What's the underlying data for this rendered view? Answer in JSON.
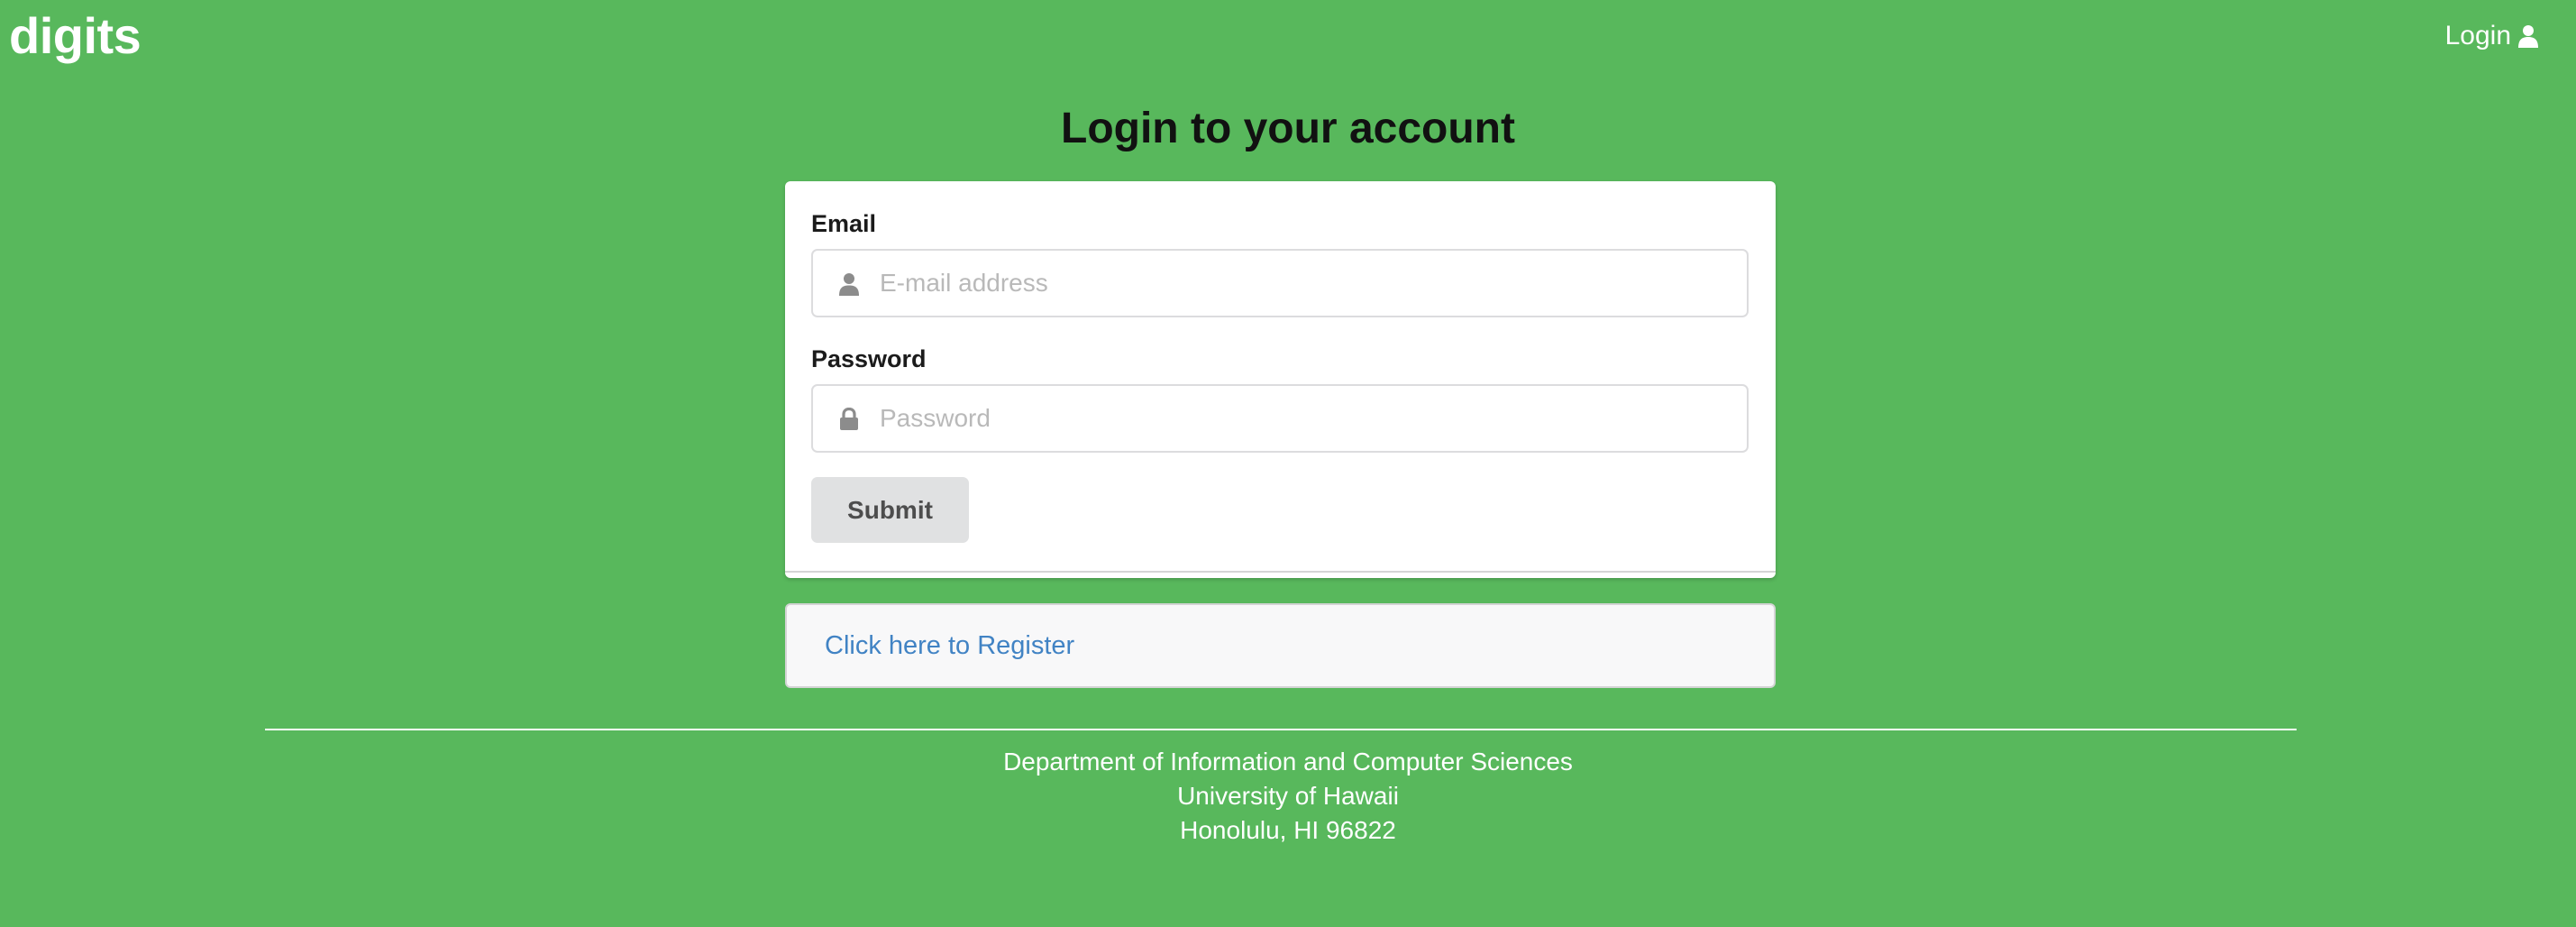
{
  "brand": {
    "name": "digits"
  },
  "nav": {
    "login_label": "Login",
    "login_icon": "user-icon"
  },
  "page": {
    "title": "Login to your account"
  },
  "form": {
    "email_label": "Email",
    "email_placeholder": "E-mail address",
    "email_value": "",
    "email_icon": "user-icon",
    "password_label": "Password",
    "password_placeholder": "Password",
    "password_value": "",
    "password_icon": "lock-icon",
    "submit_label": "Submit"
  },
  "register": {
    "link_text": "Click here to Register"
  },
  "footer": {
    "lines": [
      "Department of Information and Computer Sciences",
      "University of Hawaii",
      "Honolulu, HI 96822"
    ]
  },
  "colors": {
    "background": "#58b85c",
    "link": "#4183c4",
    "button": "#e0e1e2"
  }
}
